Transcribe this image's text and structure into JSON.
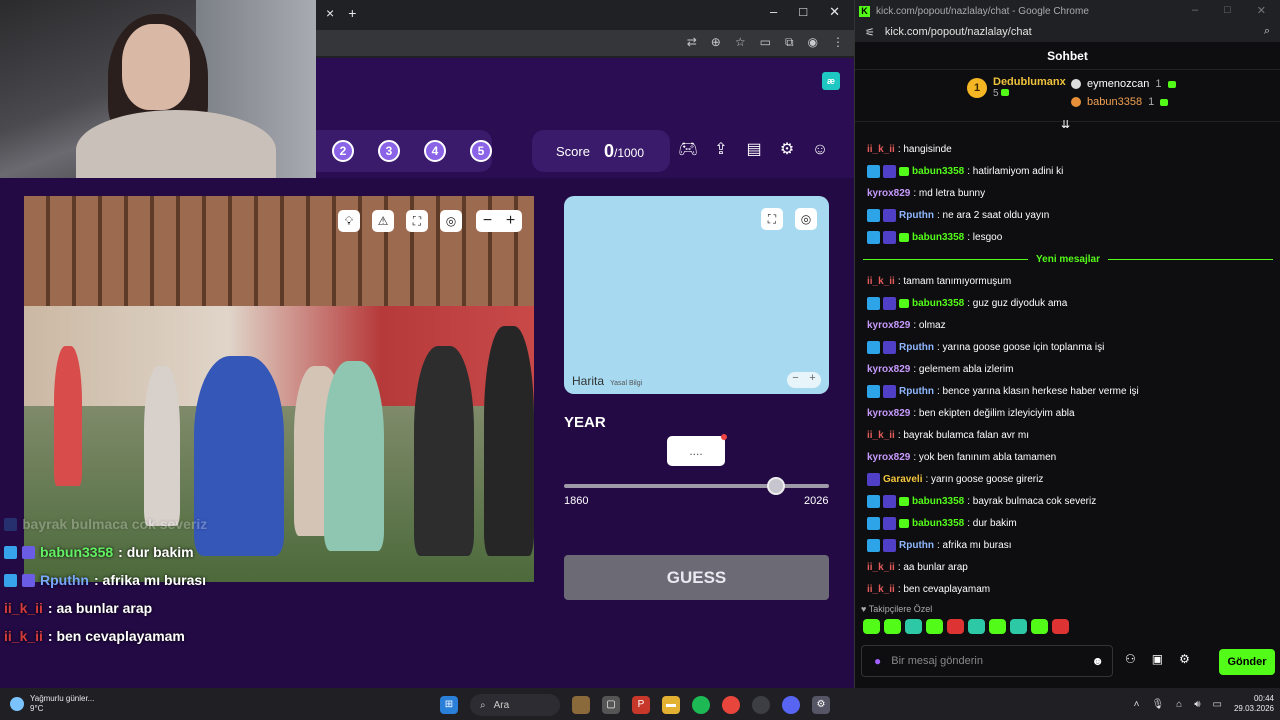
{
  "left_window": {
    "tab_close": "×",
    "tab_new": "+",
    "win_min": "–",
    "win_max": "□",
    "win_close": "✕"
  },
  "game": {
    "logo": "æ",
    "rounds": [
      "2",
      "3",
      "4",
      "5"
    ],
    "score_label": "Score",
    "score_value": "0",
    "score_max": "/1000",
    "map_brand": "Harita",
    "map_legal": "Yasal Bilgi",
    "map_zoom_out": "−",
    "map_zoom_in": "+",
    "year_label": "YEAR",
    "year_value": "....",
    "slider_min": "1860",
    "slider_max": "2026",
    "slider_fraction": 0.8,
    "guess_label": "GUESS",
    "zoom_minus": "−",
    "zoom_plus": "+"
  },
  "overlay_chat": [
    {
      "user": "bayrak bulmaca cok severiz",
      "text": "",
      "faded": true
    },
    {
      "user": "babun3358",
      "text": ": dur bakim",
      "faded": false
    },
    {
      "user": "Rputhn",
      "text": ": afrika mı burası",
      "faded": false
    },
    {
      "user": "ii_k_ii",
      "text": ": aa bunlar arap",
      "faded": false
    },
    {
      "user": "ii_k_ii",
      "text": ": ben cevaplayamam",
      "faded": false
    }
  ],
  "right_window": {
    "title": "kick.com/popout/nazlalay/chat - Google Chrome",
    "url": "kick.com/popout/nazlalay/chat",
    "chat_header": "Sohbet",
    "leader1_rank": "1",
    "leader1_name": "Dedublumanx",
    "leader1_count": "5",
    "leader2_name": "eymenozcan",
    "leader2_count": "1",
    "leader3_name": "babun3358",
    "leader3_count": "1",
    "new_messages": "Yeni mesajlar",
    "follower_only": "Takipçilere Özel",
    "input_placeholder": "Bir mesaj gönderin",
    "send_label": "Gönder"
  },
  "messages_before": [
    {
      "user": "ii_k_ii",
      "color": "red",
      "badges": [],
      "text": ": hangisinde"
    },
    {
      "user": "babun3358",
      "color": "green",
      "badges": [
        "blue",
        "star",
        "sub"
      ],
      "text": ": hatirlamiyom adini ki"
    },
    {
      "user": "kyrox829",
      "color": "purple",
      "badges": [],
      "text": ": md letra bunny"
    },
    {
      "user": "Rputhn",
      "color": "blue",
      "badges": [
        "blue",
        "star"
      ],
      "text": ": ne ara 2 saat oldu yayın"
    },
    {
      "user": "babun3358",
      "color": "green",
      "badges": [
        "blue",
        "star",
        "sub"
      ],
      "text": ": lesgoo"
    }
  ],
  "messages_after": [
    {
      "user": "ii_k_ii",
      "color": "red",
      "badges": [],
      "text": ": tamam tanımıyormuşum"
    },
    {
      "user": "babun3358",
      "color": "green",
      "badges": [
        "blue",
        "star",
        "sub"
      ],
      "text": ": guz guz diyoduk ama"
    },
    {
      "user": "kyrox829",
      "color": "purple",
      "badges": [],
      "text": ": olmaz"
    },
    {
      "user": "Rputhn",
      "color": "blue",
      "badges": [
        "blue",
        "star"
      ],
      "text": ": yarına goose goose için toplanma işi"
    },
    {
      "user": "kyrox829",
      "color": "purple",
      "badges": [],
      "text": ": gelemem abla izlerim"
    },
    {
      "user": "Rputhn",
      "color": "blue",
      "badges": [
        "blue",
        "star"
      ],
      "text": ": bence yarına klasın herkese haber verme işi"
    },
    {
      "user": "kyrox829",
      "color": "purple",
      "badges": [],
      "text": ": ben ekipten değilim izleyiciyim abla"
    },
    {
      "user": "ii_k_ii",
      "color": "red",
      "badges": [],
      "text": ": bayrak bulamca falan avr mı"
    },
    {
      "user": "kyrox829",
      "color": "purple",
      "badges": [],
      "text": ": yok ben fanınım abla tamamen"
    },
    {
      "user": "Garaveli",
      "color": "gold",
      "badges": [
        "star"
      ],
      "text": ": yarın goose goose gireriz"
    },
    {
      "user": "babun3358",
      "color": "green",
      "badges": [
        "blue",
        "star",
        "sub"
      ],
      "text": ": bayrak bulmaca cok severiz"
    },
    {
      "user": "babun3358",
      "color": "green",
      "badges": [
        "blue",
        "star",
        "sub"
      ],
      "text": ": dur bakim"
    },
    {
      "user": "Rputhn",
      "color": "blue",
      "badges": [
        "blue",
        "star"
      ],
      "text": ": afrika mı burası"
    },
    {
      "user": "ii_k_ii",
      "color": "red",
      "badges": [],
      "text": ": aa bunlar arap"
    },
    {
      "user": "ii_k_ii",
      "color": "red",
      "badges": [],
      "text": ": ben cevaplayamam"
    }
  ],
  "taskbar": {
    "weather_text": "Yağmurlu günler...",
    "weather_temp": "9°C",
    "search_label": "Ara",
    "time": "00:44",
    "date": "29.03.2026"
  }
}
